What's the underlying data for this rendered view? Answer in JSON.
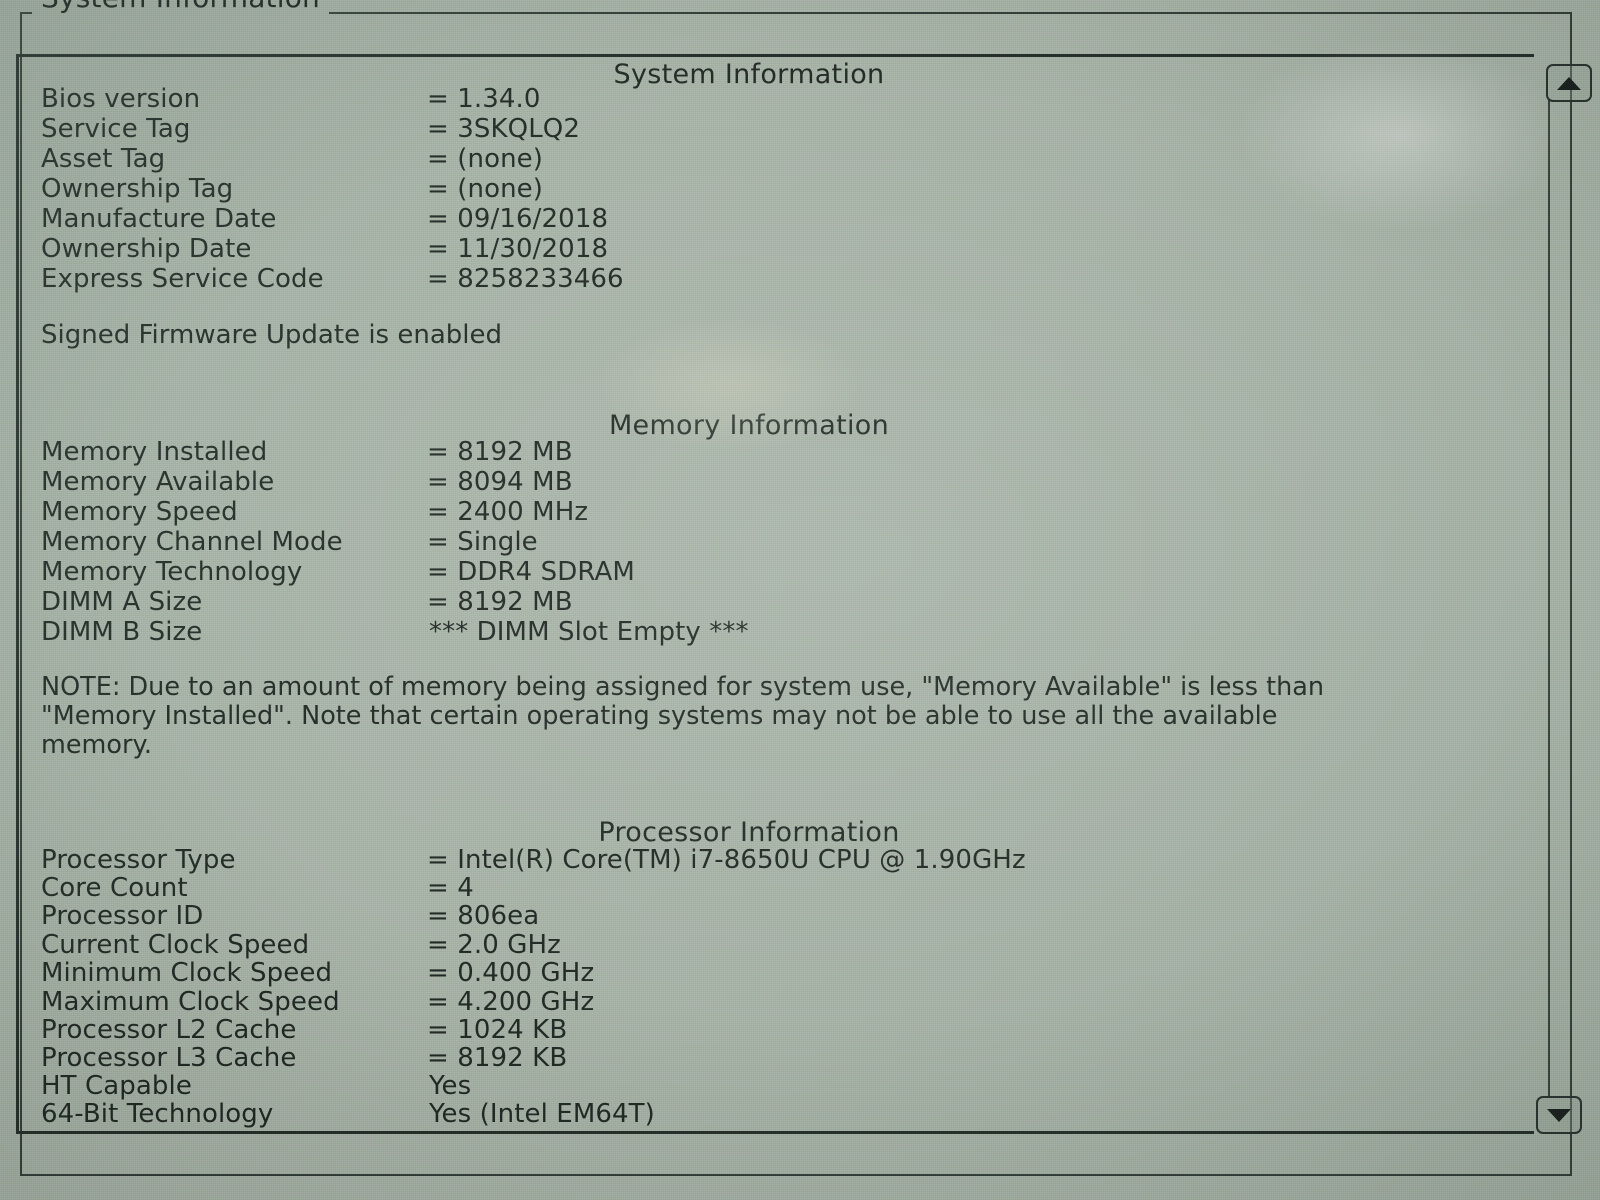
{
  "screen": {
    "group_title": "System Information",
    "background_color": "#a6b2a6",
    "text_color": "#18201c"
  },
  "sections": {
    "system": {
      "title": "System Information",
      "rows": [
        {
          "label": "Bios version",
          "value": "= 1.34.0"
        },
        {
          "label": "Service Tag",
          "value": "= 3SKQLQ2"
        },
        {
          "label": "Asset Tag",
          "value": "= (none)"
        },
        {
          "label": "Ownership Tag",
          "value": "= (none)"
        },
        {
          "label": "Manufacture Date",
          "value": "= 09/16/2018"
        },
        {
          "label": "Ownership Date",
          "value": "= 11/30/2018"
        },
        {
          "label": "Express Service Code",
          "value": "= 8258233466"
        }
      ],
      "status": "Signed Firmware Update is enabled"
    },
    "memory": {
      "title": "Memory Information",
      "rows": [
        {
          "label": "Memory Installed",
          "value": "= 8192 MB"
        },
        {
          "label": "Memory Available",
          "value": "= 8094 MB"
        },
        {
          "label": "Memory Speed",
          "value": "= 2400 MHz"
        },
        {
          "label": "Memory Channel Mode",
          "value": "= Single"
        },
        {
          "label": "Memory Technology",
          "value": "= DDR4 SDRAM"
        },
        {
          "label": "DIMM A Size",
          "value": "= 8192 MB"
        },
        {
          "label": "DIMM B Size",
          "value": "*** DIMM Slot Empty ***"
        }
      ],
      "note": "NOTE: Due to an amount of memory being assigned for system use, \"Memory Available\" is less than \"Memory Installed\". Note that certain operating systems may not be able to use all the available memory."
    },
    "processor": {
      "title": "Processor Information",
      "rows": [
        {
          "label": "Processor Type",
          "value": "= Intel(R) Core(TM) i7-8650U CPU @ 1.90GHz"
        },
        {
          "label": "Core Count",
          "value": "= 4"
        },
        {
          "label": "Processor ID",
          "value": "= 806ea"
        },
        {
          "label": "Current Clock Speed",
          "value": "= 2.0 GHz"
        },
        {
          "label": "Minimum Clock Speed",
          "value": "= 0.400 GHz"
        },
        {
          "label": "Maximum Clock Speed",
          "value": "= 4.200 GHz"
        },
        {
          "label": "Processor L2 Cache",
          "value": "= 1024 KB"
        },
        {
          "label": "Processor L3 Cache",
          "value": "= 8192 KB"
        },
        {
          "label": "HT Capable",
          "value": "Yes"
        },
        {
          "label": "64-Bit Technology",
          "value": "Yes (Intel EM64T)"
        }
      ]
    }
  },
  "scrollbar": {
    "up_label": "scroll up",
    "down_label": "scroll down"
  }
}
